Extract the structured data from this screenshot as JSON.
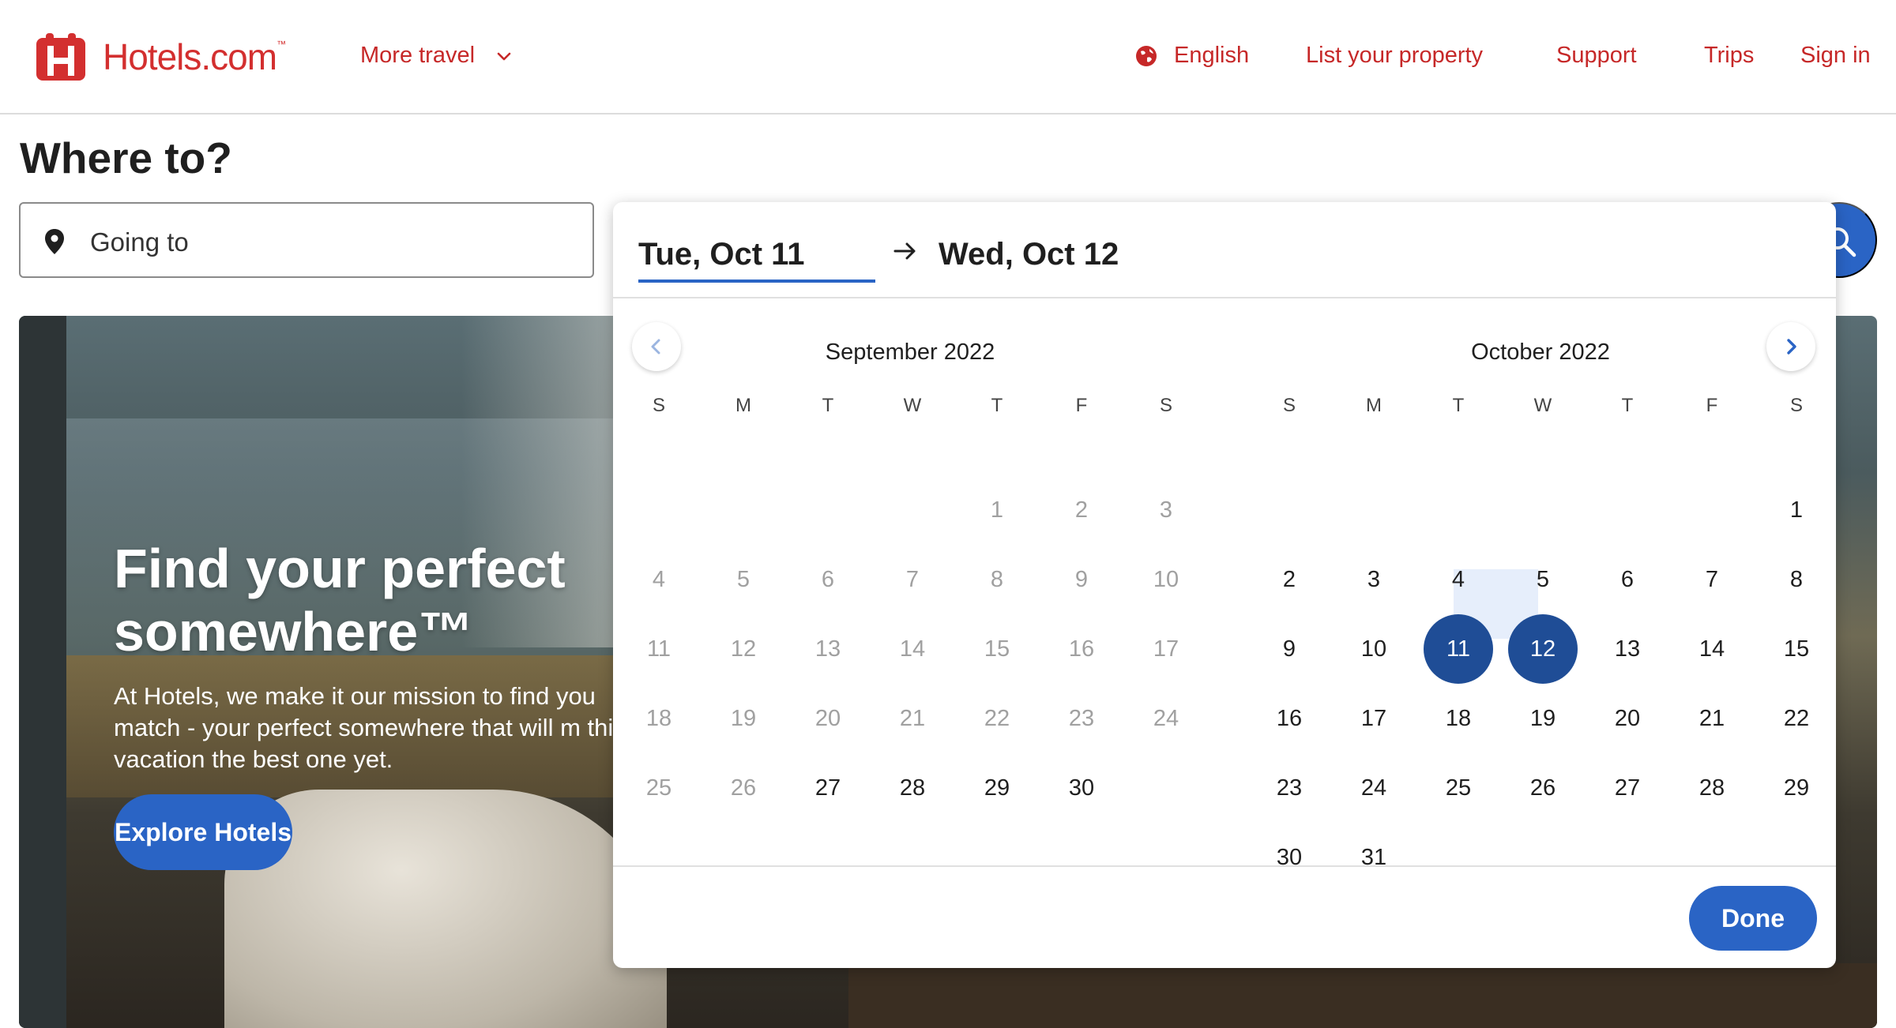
{
  "header": {
    "logo_text": "Hotels.com",
    "logo_tm": "™",
    "more_travel": "More travel",
    "language": "English",
    "list_property": "List your property",
    "support": "Support",
    "trips": "Trips",
    "sign_in": "Sign in",
    "brand_color": "#d32f2f"
  },
  "search": {
    "title": "Where to?",
    "going_to_placeholder": "Going to"
  },
  "hero": {
    "title": "Find your perfect somewhere™",
    "description": "At Hotels, we make it our mission to find you match - your perfect somewhere that will m this vacation the best one yet.",
    "cta": "Explore Hotels"
  },
  "date_picker": {
    "start_date": "Tue, Oct 11",
    "end_date": "Wed, Oct 12",
    "accent_color": "#2a64c5",
    "selected_color": "#1f4d96",
    "weekdays": [
      "S",
      "M",
      "T",
      "W",
      "T",
      "F",
      "S"
    ],
    "months": [
      {
        "title": "September 2022",
        "first_weekday": 4,
        "days": 30,
        "disabled_before": 27
      },
      {
        "title": "October 2022",
        "first_weekday": 6,
        "days": 31,
        "disabled_before": 1,
        "selected": [
          11,
          12
        ]
      }
    ],
    "done_label": "Done"
  },
  "icons": {
    "logo": "hotels-logo-icon",
    "chevron": "chevron-down-icon",
    "globe": "globe-icon",
    "pin": "location-pin-icon",
    "search": "search-icon",
    "arrow": "arrow-right-icon",
    "prev": "chevron-left-icon",
    "next": "chevron-right-icon"
  }
}
